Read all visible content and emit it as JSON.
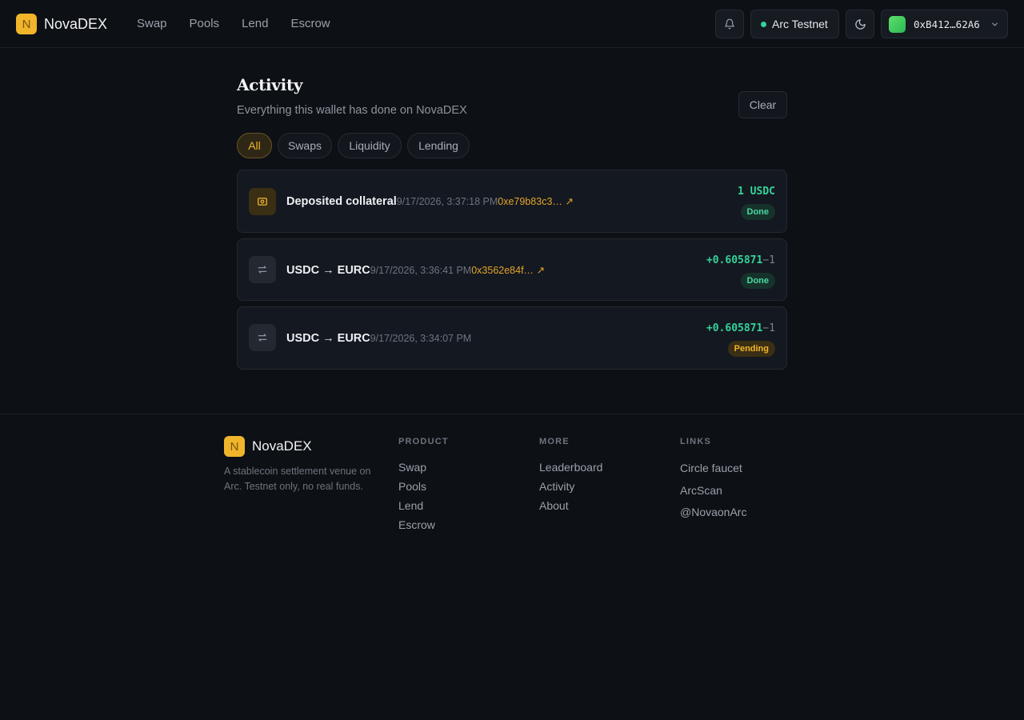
{
  "header": {
    "logo_letter": "N",
    "brand": "NovaDEX",
    "nav": [
      "Swap",
      "Pools",
      "Lend",
      "Escrow"
    ],
    "network": "Arc Testnet",
    "wallet_address": "0xB412…62A6"
  },
  "page": {
    "title": "Activity",
    "subtitle": "Everything this wallet has done on NovaDEX",
    "clear_label": "Clear",
    "filters": [
      "All",
      "Swaps",
      "Liquidity",
      "Lending"
    ],
    "active_filter": "All"
  },
  "activity": [
    {
      "icon": "vault-icon",
      "title": "Deposited collateral",
      "time": "9/17/2026, 3:37:18 PM",
      "hash": "0xe79b83c3… ↗",
      "amount": "1 USDC",
      "amount_neg": "",
      "status": "Done"
    },
    {
      "icon": "swap-icon",
      "title": "USDC → EURC",
      "time": "9/17/2026, 3:36:41 PM",
      "hash": "0x3562e84f… ↗",
      "amount": "+0.605871",
      "amount_neg": "−1",
      "status": "Done"
    },
    {
      "icon": "swap-icon",
      "title": "USDC → EURC",
      "time": "9/17/2026, 3:34:07 PM",
      "hash": "",
      "amount": "+0.605871",
      "amount_neg": "−1",
      "status": "Pending"
    }
  ],
  "footer": {
    "brand": "NovaDEX",
    "tagline": "A stablecoin settlement venue on Arc. Testnet only, no real funds.",
    "columns": [
      {
        "heading": "PRODUCT",
        "links": [
          "Swap",
          "Pools",
          "Lend",
          "Escrow"
        ]
      },
      {
        "heading": "MORE",
        "links": [
          "Leaderboard",
          "Activity",
          "About"
        ]
      },
      {
        "heading": "LINKS",
        "links": [
          "Circle faucet",
          "ArcScan",
          "@NovaonArc"
        ]
      }
    ]
  },
  "colors": {
    "accent": "#f1b52b",
    "success": "#34d399",
    "background": "#0d1015"
  }
}
